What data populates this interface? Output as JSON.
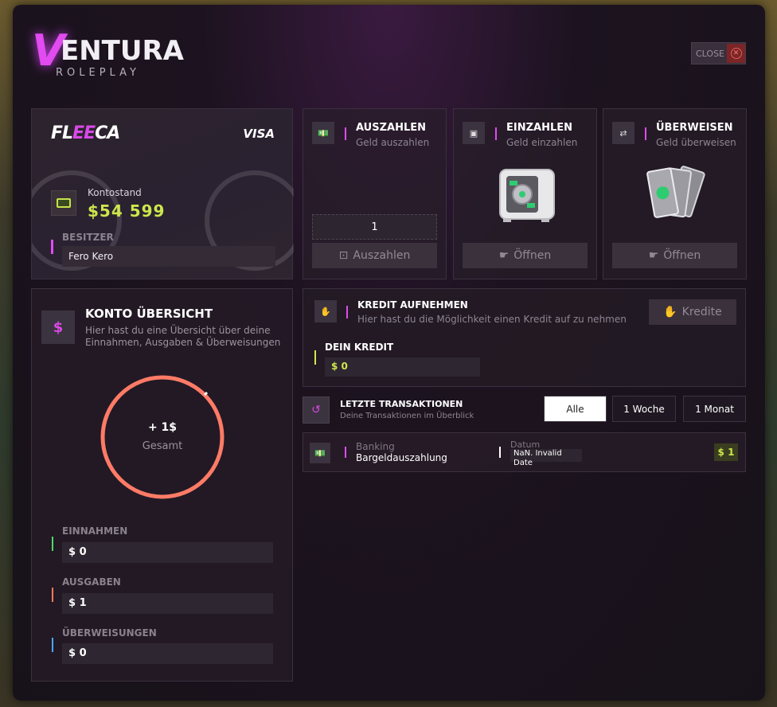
{
  "logo": {
    "v": "V",
    "rest": "ENTURA",
    "sub": "ROLEPLAY"
  },
  "close": {
    "label": "CLOSE",
    "icon": "close-icon"
  },
  "card": {
    "brand_pre": "FL",
    "brand_mid": "EE",
    "brand_post": "CA",
    "network": "VISA",
    "balance_label": "Kontostand",
    "balance_value": "$54 599",
    "owner_label": "BESITZER",
    "owner_value": "Fero Kero"
  },
  "actions": [
    {
      "title": "AUSZAHLEN",
      "sub": "Geld auszahlen",
      "amount": "1",
      "button": "Auszahlen",
      "icon": "cash-icon"
    },
    {
      "title": "EINZAHLEN",
      "sub": "Geld einzahlen",
      "button": "Öffnen",
      "icon": "safe-icon"
    },
    {
      "title": "ÜBERWEISEN",
      "sub": "Geld überweisen",
      "button": "Öffnen",
      "icon": "transfer-icon"
    }
  ],
  "overview": {
    "title": "KONTO ÜBERSICHT",
    "desc": "Hier hast du eine Übersicht über deine Einnahmen, Ausgaben & Überweisungen",
    "ring_value": "+ 1$",
    "ring_label": "Gesamt",
    "income_label": "EINNAHMEN",
    "income_value": "$ 0",
    "expense_label": "AUSGABEN",
    "expense_value": "$ 1",
    "transfer_label": "ÜBERWEISUNGEN",
    "transfer_value": "$ 0",
    "colors": {
      "income": "#4cd964",
      "expense": "#ff7b5c",
      "transfer": "#4aa8ff",
      "ring": "#ff7b66"
    }
  },
  "credit": {
    "title": "KREDIT AUFNEHMEN",
    "sub": "Hier hast du die Möglichkeit einen Kredit auf zu nehmen",
    "button": "Kredite",
    "my_label": "DEIN KREDIT",
    "my_value": "$ 0"
  },
  "transactions": {
    "title": "LETZTE TRANSAKTIONEN",
    "sub": "Deine Transaktionen im Überblick",
    "filters": [
      "Alle",
      "1 Woche",
      "1 Monat"
    ],
    "active_filter": "Alle",
    "rows": [
      {
        "type": "Banking",
        "name": "Bargeldauszahlung",
        "date_label": "Datum",
        "date_value_1": "NaN. Invalid",
        "date_value_2": "Date",
        "amount": "$ 1"
      }
    ]
  }
}
